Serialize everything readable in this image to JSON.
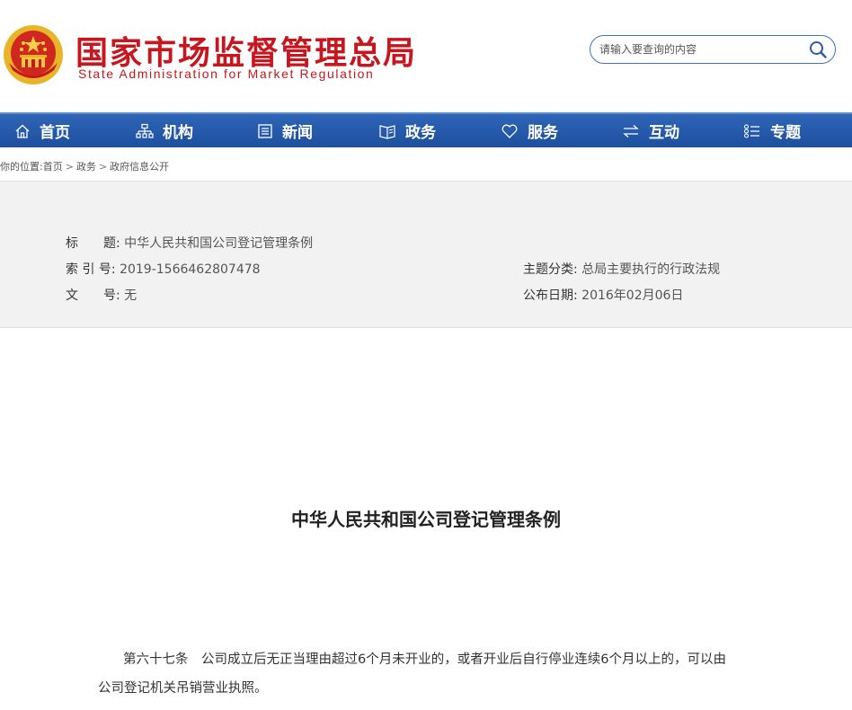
{
  "header": {
    "title_cn": "国家市场监督管理总局",
    "title_en": "State Administration for Market Regulation",
    "emblem_icon": "national-emblem-icon",
    "brand_color": "#c8161e"
  },
  "search": {
    "placeholder": "请输入要查询的内容",
    "icon": "search-icon"
  },
  "nav": {
    "items": [
      {
        "label": "首页",
        "icon": "home-icon"
      },
      {
        "label": "机构",
        "icon": "org-chart-icon"
      },
      {
        "label": "新闻",
        "icon": "news-icon"
      },
      {
        "label": "政务",
        "icon": "book-icon"
      },
      {
        "label": "服务",
        "icon": "heart-icon"
      },
      {
        "label": "互动",
        "icon": "exchange-icon"
      },
      {
        "label": "专题",
        "icon": "list-icon"
      }
    ],
    "color": "#2a5fb0"
  },
  "breadcrumb": {
    "prefix": "你的位置:",
    "items": [
      "首页",
      "政务",
      "政府信息公开"
    ],
    "separator": ">"
  },
  "info": {
    "title_label": "标　　题:",
    "title_value": "中华人民共和国公司登记管理条例",
    "index_label": "索 引 号:",
    "index_value": "2019-1566462807478",
    "doc_label": "文　　号:",
    "doc_value": "无",
    "topic_label": "主题分类:",
    "topic_value": "总局主要执行的行政法规",
    "date_label": "公布日期:",
    "date_value": "2016年02月06日"
  },
  "article": {
    "title": "中华人民共和国公司登记管理条例",
    "para1_line1": "第六十七条　公司成立后无正当理由超过6个月未开业的，或者开业后自行停业连续6个月以上的，可以由",
    "para1_line2": "公司登记机关吊销营业执照。"
  }
}
